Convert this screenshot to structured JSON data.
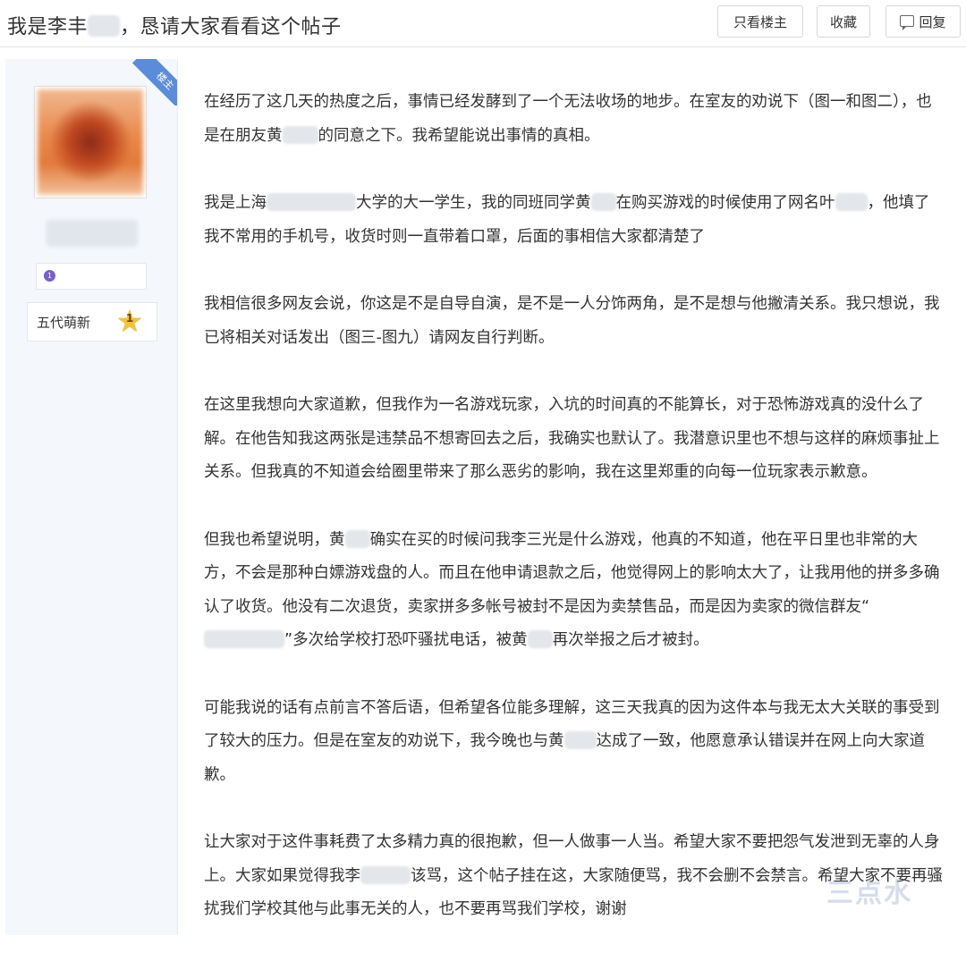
{
  "post": {
    "title_part1": "我是李",
    "title_mid": "丰",
    "title_part2": "，恳请大家看看这个帖子"
  },
  "header_buttons": {
    "only_op": "只看楼主",
    "favorite": "收藏",
    "reply": "回复"
  },
  "author": {
    "op_ribbon": "楼主",
    "badge_number": "1",
    "level_label": "五代萌新",
    "level_number": "1"
  },
  "paragraphs": {
    "p1a": "在经历了这几天的热度之后，事情已经发酵到了一个无法收场的地步。在室友的劝说下（图一和图二），也是在朋友黄",
    "p1b": "的同意之下。我希望能说出事情的真相。",
    "p2a": "我是上海",
    "p2b": "大学的大一学生，我的同班同学黄",
    "p2c": "在购买游戏的时候使用了网名叶",
    "p2d": "，他填了我不常用的手机号，收货时则一直带着口罩，后面的事相信大家都清楚了",
    "p3": "我相信很多网友会说，你这是不是自导自演，是不是一人分饰两角，是不是想与他撇清关系。我只想说，我已将相关对话发出（图三-图九）请网友自行判断。",
    "p4": "在这里我想向大家道歉，但我作为一名游戏玩家，入坑的时间真的不能算长，对于恐怖游戏真的没什么了解。在他告知我这两张是违禁品不想寄回去之后，我确实也默认了。我潜意识里也不想与这样的麻烦事扯上关系。但我真的不知道会给圈里带来了那么恶劣的影响，我在这里郑重的向每一位玩家表示歉意。",
    "p5a": "但我也希望说明，黄",
    "p5b": "确实在买的时候问我李三光是什么游戏，他真的不知道，他在平日里也非常的大方，不会是那种白嫖游戏盘的人。而且在他申请退款之后，他觉得网上的影响太大了，让我用他的拼多多确认了收货。他没有二次退货，卖家拼多多帐号被封不是因为卖禁售品，而是因为卖家的微信群友“",
    "p5c": "”多次给学校打恐吓骚扰电话，被黄",
    "p5d": "再次举报之后才被封。",
    "p6a": "可能我说的话有点前言不答后语，但希望各位能多理解，这三天我真的因为这件本与我无太大关联的事受到了较大的压力。但是在室友的劝说下，我今晚也与黄",
    "p6b": "达成了一致，他愿意承认错误并在网上向大家道歉。",
    "p7a": "让大家对于这件事耗费了太多精力真的很抱歉，但一人做事一人当。希望大家不要把怨气发泄到无辜的人身上。大家如果觉得我李",
    "p7b": "该骂，这个帖子挂在这，大家随便骂，我不会删不会禁言。希望大家不要再骚扰我们学校其他与此事无关的人，也不要再骂我们学校，谢谢"
  },
  "watermark": "三点水"
}
